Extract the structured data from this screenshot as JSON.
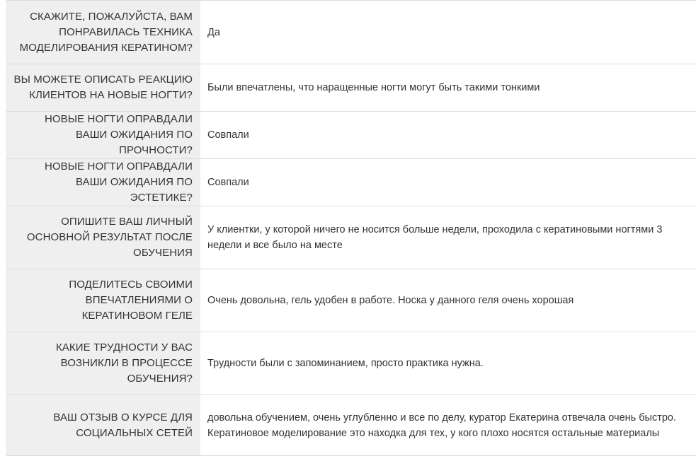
{
  "rows": [
    {
      "question": "Скажите, пожалуйста, вам понравилась техника моделирования кератином?",
      "answer": "Да"
    },
    {
      "question": "Вы можете описать реакцию клиентов на новые ногти?",
      "answer": "Были впечатлены, что наращенные ногти могут быть такими тонкими"
    },
    {
      "question": "Новые ногти оправдали ваши ожидания по прочности?",
      "answer": "Совпали"
    },
    {
      "question": "Новые ногти оправдали ваши ожидания по эстетике?",
      "answer": "Совпали"
    },
    {
      "question": "Опишите ваш личный основной результат после обучения",
      "answer": "У клиентки, у которой ничего не носится больше недели, проходила с кератиновыми ногтями 3 недели и все было на месте"
    },
    {
      "question": "Поделитесь своими впечатлениями о кератиновом геле",
      "answer": "Очень довольна, гель удобен в работе. Носка у данного геля очень хорошая"
    },
    {
      "question": "Какие трудности у вас возникли в процессе обучения?",
      "answer": "Трудности были с запоминанием, просто практика нужна."
    },
    {
      "question": "Ваш отзыв о курсе для социальных сетей",
      "answer": "довольна обучением, очень углубленно и все по делу, куратор Екатерина отвечала очень быстро. Кератиновое моделирование это находка для тех, у кого плохо носятся остальные материалы"
    }
  ]
}
